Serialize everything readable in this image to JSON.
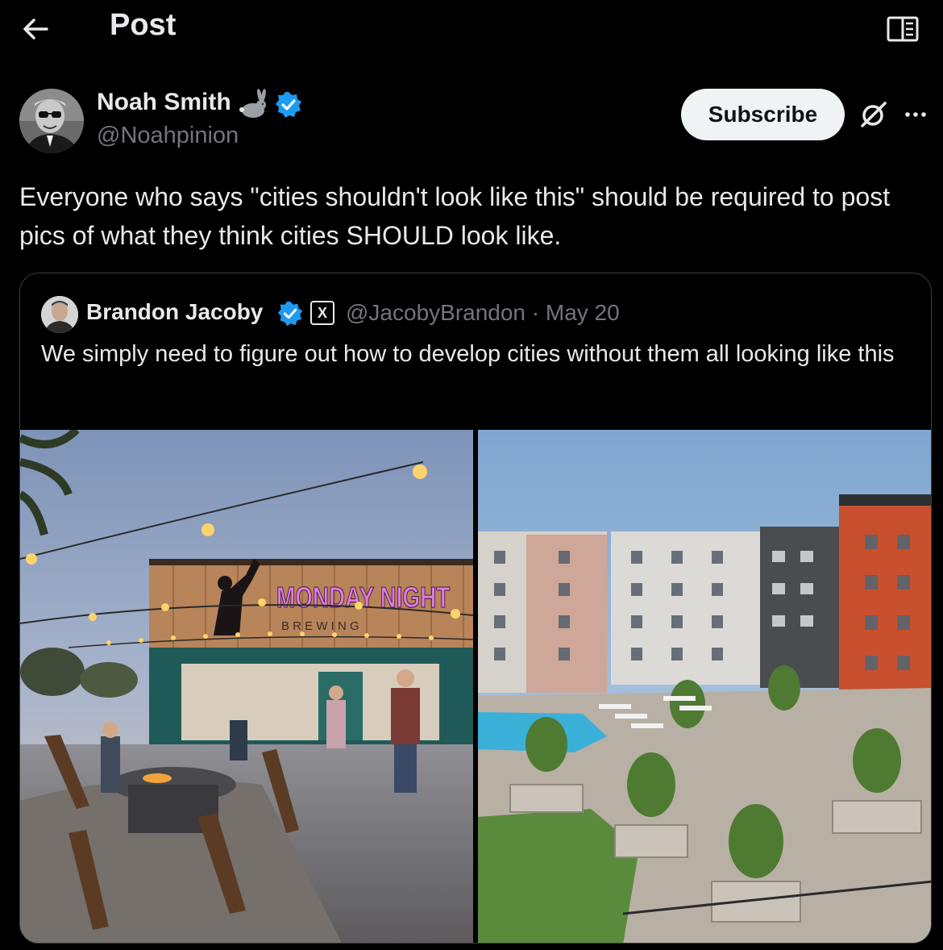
{
  "header": {
    "back_icon": "arrow-left-icon",
    "title": "Post",
    "reader_icon": "book-reader-icon"
  },
  "author": {
    "name": "Noah Smith",
    "handle": "@Noahpinion",
    "name_emoji_icon": "rabbit-icon",
    "verified_icon": "verified-badge-icon",
    "subscribe_label": "Subscribe",
    "grok_icon": "grok-icon",
    "more_icon": "more-dots-icon"
  },
  "post": {
    "text": "Everyone who says \"cities shouldn't look like this\" should be required to post pics of what they think cities SHOULD look like."
  },
  "quote": {
    "name": "Brandon Jacoby",
    "verified_icon": "verified-badge-icon",
    "affiliate_badge": "X",
    "meta": "@JacobyBrandon · May 20",
    "text": "We simply need to figure out how to develop cities without them all looking like this",
    "images": [
      {
        "sign_title": "MONDAY NIGHT",
        "sign_subtitle": "B R E W I N G"
      }
    ]
  },
  "colors": {
    "background": "#000000",
    "text": "#e7e9ea",
    "muted": "#71767b",
    "verified": "#1d9bf0",
    "card_border": "#3a3f44",
    "subscribe_bg": "#eff3f4"
  }
}
